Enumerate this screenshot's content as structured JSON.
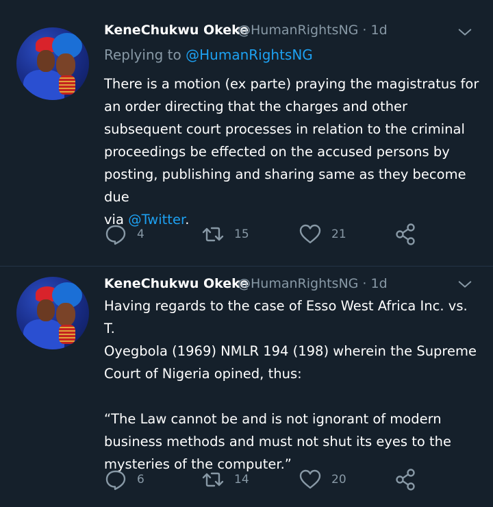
{
  "tweets": [
    {
      "author_name": "KeneChukwu Okeke",
      "handle_time": "@HumanRightsNG · 1d",
      "replying_prefix": "Replying to ",
      "replying_to": "@HumanRightsNG",
      "body": "There is a motion (ex parte) praying the magistratus for\nan order directing that the charges and other\nsubsequent court processes in relation to the criminal\nproceedings be effected on the accused persons by\nposting, publishing and sharing same as they become due\nvia ",
      "body_link": "@Twitter",
      "body_end": ".",
      "replies": "4",
      "retweets": "15",
      "likes": "21"
    },
    {
      "author_name": "KeneChukwu Okeke",
      "handle_time": "@HumanRightsNG · 1d",
      "body": "Having regards to the case of Esso West Africa Inc. vs. T.\nOyegbola (1969) NMLR 194 (198) wherein the Supreme\nCourt of Nigeria opined, thus:\n\n“The Law cannot be and is not ignorant of modern\nbusiness methods and must not shut its eyes to the\nmysteries of the computer.”",
      "replies": "6",
      "retweets": "14",
      "likes": "20"
    }
  ],
  "colors": {
    "background": "#15202b",
    "text": "#ffffff",
    "secondary": "#8899a6",
    "accent": "#1da1f2"
  },
  "icons": [
    "chevron-down-icon",
    "reply-icon",
    "retweet-icon",
    "like-icon",
    "share-icon"
  ]
}
